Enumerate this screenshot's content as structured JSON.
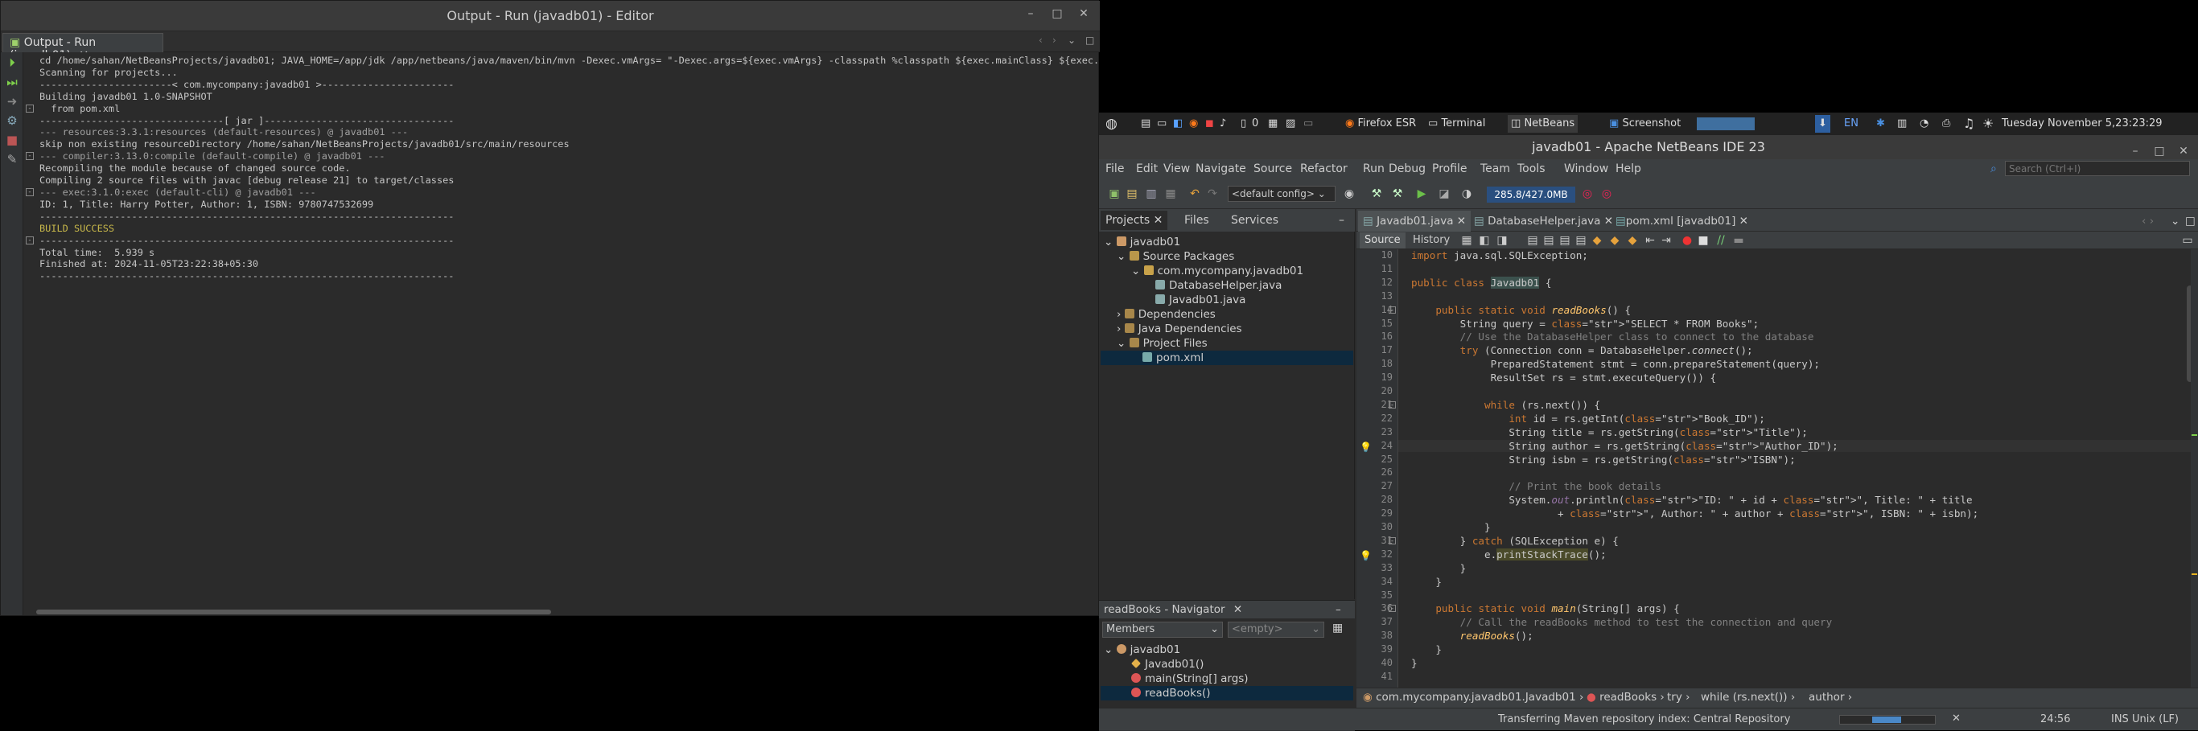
{
  "output_window": {
    "title": "Output - Run (javadb01) - Editor",
    "tab_label": "Output - Run (javadb01)",
    "lines": [
      {
        "text": "cd /home/sahan/NetBeansProjects/javadb01; JAVA_HOME=/app/jdk /app/netbeans/java/maven/bin/mvn -Dexec.vmArgs= \"-Dexec.args=${exec.vmArgs} -classpath %classpath ${exec.mainClass} ${exec.appArgs}\"",
        "fold": ""
      },
      {
        "text": "Scanning for projects...",
        "fold": ""
      },
      {
        "text": "",
        "fold": ""
      },
      {
        "text": "-----------------------< com.mycompany:javadb01 >-----------------------",
        "fold": ""
      },
      {
        "text": "Building javadb01 1.0-SNAPSHOT",
        "fold": "-"
      },
      {
        "text": "  from pom.xml",
        "fold": ""
      },
      {
        "text": "--------------------------------[ jar ]---------------------------------",
        "fold": ""
      },
      {
        "text": "",
        "fold": ""
      },
      {
        "text": "--- resources:3.3.1:resources (default-resources) @ javadb01 ---",
        "fold": "-"
      },
      {
        "text": "skip non existing resourceDirectory /home/sahan/NetBeansProjects/javadb01/src/main/resources",
        "fold": ""
      },
      {
        "text": "",
        "fold": ""
      },
      {
        "text": "--- compiler:3.13.0:compile (default-compile) @ javadb01 ---",
        "fold": "-"
      },
      {
        "text": "Recompiling the module because of changed source code.",
        "fold": ""
      },
      {
        "text": "Compiling 2 source files with javac [debug release 21] to target/classes",
        "fold": ""
      },
      {
        "text": "",
        "fold": ""
      },
      {
        "text": "--- exec:3.1.0:exec (default-cli) @ javadb01 ---",
        "fold": "-"
      },
      {
        "text": "ID: 1, Title: Harry Potter, Author: 1, ISBN: 9780747532699",
        "fold": ""
      },
      {
        "text": "------------------------------------------------------------------------",
        "fold": ""
      },
      {
        "text": "BUILD SUCCESS",
        "fold": ""
      },
      {
        "text": "------------------------------------------------------------------------",
        "fold": ""
      },
      {
        "text": "Total time:  5.939 s",
        "fold": ""
      },
      {
        "text": "Finished at: 2024-11-05T23:22:38+05:30",
        "fold": ""
      },
      {
        "text": "------------------------------------------------------------------------",
        "fold": ""
      }
    ],
    "success_color": "#c8b84a"
  },
  "taskbar": {
    "workspace_num": "0",
    "apps": [
      "Firefox ESR",
      "Terminal",
      "NetBeans",
      "Screenshot"
    ],
    "lang": "EN",
    "datetime": "Tuesday November  5,23:23:29"
  },
  "netbeans": {
    "title": "javadb01 - Apache NetBeans IDE 23",
    "menu": [
      "File",
      "Edit",
      "View",
      "Navigate",
      "Source",
      "Refactor",
      "Run",
      "Debug",
      "Profile",
      "Team",
      "Tools",
      "Window",
      "Help"
    ],
    "search_placeholder": "Search (Ctrl+I)",
    "config": "<default config>",
    "memory": "285.8/427.0MB",
    "project_tabs": [
      "Projects",
      "Files",
      "Services"
    ],
    "tree": [
      "javadb01",
      "Source Packages",
      "com.mycompany.javadb01",
      "DatabaseHelper.java",
      "Javadb01.java",
      "Dependencies",
      "Java Dependencies",
      "Project Files",
      "pom.xml"
    ],
    "navigator": {
      "title": "readBooks - Navigator",
      "filter": "Members",
      "empty": "<empty>",
      "items": [
        "javadb01",
        "Javadb01()",
        "main(String[] args)",
        "readBooks()"
      ]
    },
    "editor_tabs": [
      "Javadb01.java",
      "DatabaseHelper.java",
      "pom.xml [javadb01]"
    ],
    "editor_modes": [
      "Source",
      "History"
    ],
    "line_numbers": [
      "10",
      "11",
      "12",
      "13",
      "14",
      "15",
      "16",
      "17",
      "18",
      "19",
      "20",
      "21",
      "22",
      "23",
      "24",
      "25",
      "26",
      "27",
      "28",
      "29",
      "30",
      "31",
      "32",
      "33",
      "34",
      "35",
      "36",
      "37",
      "38",
      "39",
      "40",
      "41"
    ],
    "code": [
      "import java.sql.SQLException;",
      "",
      "public class Javadb01 {",
      "",
      "    public static void readBooks() {",
      "        String query = \"SELECT * FROM Books\";",
      "        // Use the DatabaseHelper class to connect to the database",
      "        try (Connection conn = DatabaseHelper.connect();",
      "             PreparedStatement stmt = conn.prepareStatement(query);",
      "             ResultSet rs = stmt.executeQuery()) {",
      "",
      "            while (rs.next()) {",
      "                int id = rs.getInt(\"Book_ID\");",
      "                String title = rs.getString(\"Title\");",
      "                String author = rs.getString(\"Author_ID\");",
      "                String isbn = rs.getString(\"ISBN\");",
      "",
      "                // Print the book details",
      "                System.out.println(\"ID: \" + id + \", Title: \" + title",
      "                        + \", Author: \" + author + \", ISBN: \" + isbn);",
      "            }",
      "        } catch (SQLException e) {",
      "            e.printStackTrace();",
      "        }",
      "    }",
      "",
      "    public static void main(String[] args) {",
      "        // Call the readBooks method to test the connection and query",
      "        readBooks();",
      "    }",
      "}",
      ""
    ],
    "breadcrumb": [
      "com.mycompany.javadb01.Javadb01",
      "readBooks",
      "try",
      "while (rs.next())",
      "author"
    ],
    "status": {
      "task": "Transferring Maven repository index: Central Repository",
      "position": "24:56",
      "mode": "INS Unix (LF)"
    }
  }
}
